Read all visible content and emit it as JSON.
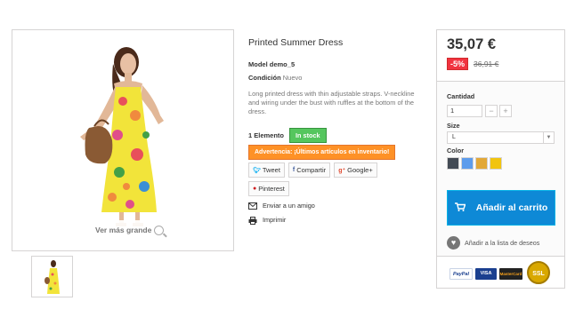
{
  "product": {
    "title": "Printed Summer Dress",
    "model_label": "Model",
    "model_value": "demo_5",
    "condition_label": "Condición",
    "condition_value": "Nuevo",
    "description": "Long printed dress with thin adjustable straps. V-neckline and wiring under the bust with ruffles at the bottom of the dress.",
    "stock_qty": "1 Elemento",
    "stock_badge": "In stock",
    "warning": "Advertencia: ¡Últimos artículos en inventario!",
    "zoom_label": "Ver más grande"
  },
  "social": {
    "tweet": "Tweet",
    "share": "Compartir",
    "google": "Google+",
    "pinterest": "Pinterest",
    "tweet_icon": "twitter-icon",
    "share_icon": "facebook-icon",
    "google_icon": "google-plus-icon",
    "pinterest_icon": "pinterest-icon"
  },
  "links": {
    "send_friend": "Enviar a un amigo",
    "print": "Imprimir"
  },
  "buy": {
    "price": "35,07 €",
    "discount": "-5%",
    "old_price": "36,91 €",
    "quantity_label": "Cantidad",
    "quantity_value": "1",
    "size_label": "Size",
    "size_value": "L",
    "color_label": "Color",
    "colors": [
      "#434a54",
      "#5d9cec",
      "#e2a838",
      "#f1c40f"
    ],
    "add_to_cart": "Añadir al carrito",
    "wishlist": "Añadir a la lista de deseos"
  },
  "payment": {
    "paypal": "PayPal",
    "visa": "VISA",
    "mastercard": "MasterCard",
    "ssl": "SSL"
  },
  "colors": {
    "accent": "#0e89d6",
    "stock": "#55c65e",
    "warning": "#fe9126",
    "discount": "#f13340"
  }
}
